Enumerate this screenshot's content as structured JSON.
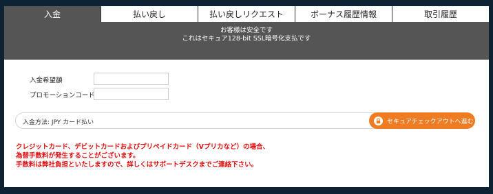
{
  "tabs": [
    {
      "label": "入金",
      "active": true
    },
    {
      "label": "払い戻し",
      "active": false
    },
    {
      "label": "払い戻しリクエスト",
      "active": false
    },
    {
      "label": "ボーナス履歴情報",
      "active": false
    },
    {
      "label": "取引履歴",
      "active": false
    }
  ],
  "banner": {
    "line1": "お客様は安全です",
    "line2": "これはセキュア128-bit SSL暗号化支払です"
  },
  "form": {
    "amount_label": "入金希望額",
    "amount_value": "",
    "promo_label": "プロモーションコード",
    "promo_value": ""
  },
  "payment": {
    "method_label": "入金方法: JPY カード払い",
    "checkout_label": "セキュアチェックアウトへ進む",
    "checkout_icon": "lock-icon",
    "accent_color": "#ef7b22"
  },
  "notice": {
    "line1": "クレジットカード、デビットカードおよびプリペイドカード（Vプリカなど）の場合、",
    "line2": "為替手数料が発生することがございます。",
    "line3": "手数料は弊社負担といたしますので、詳しくはサポートデスクまでご連絡下さい。",
    "color": "#e01010"
  }
}
